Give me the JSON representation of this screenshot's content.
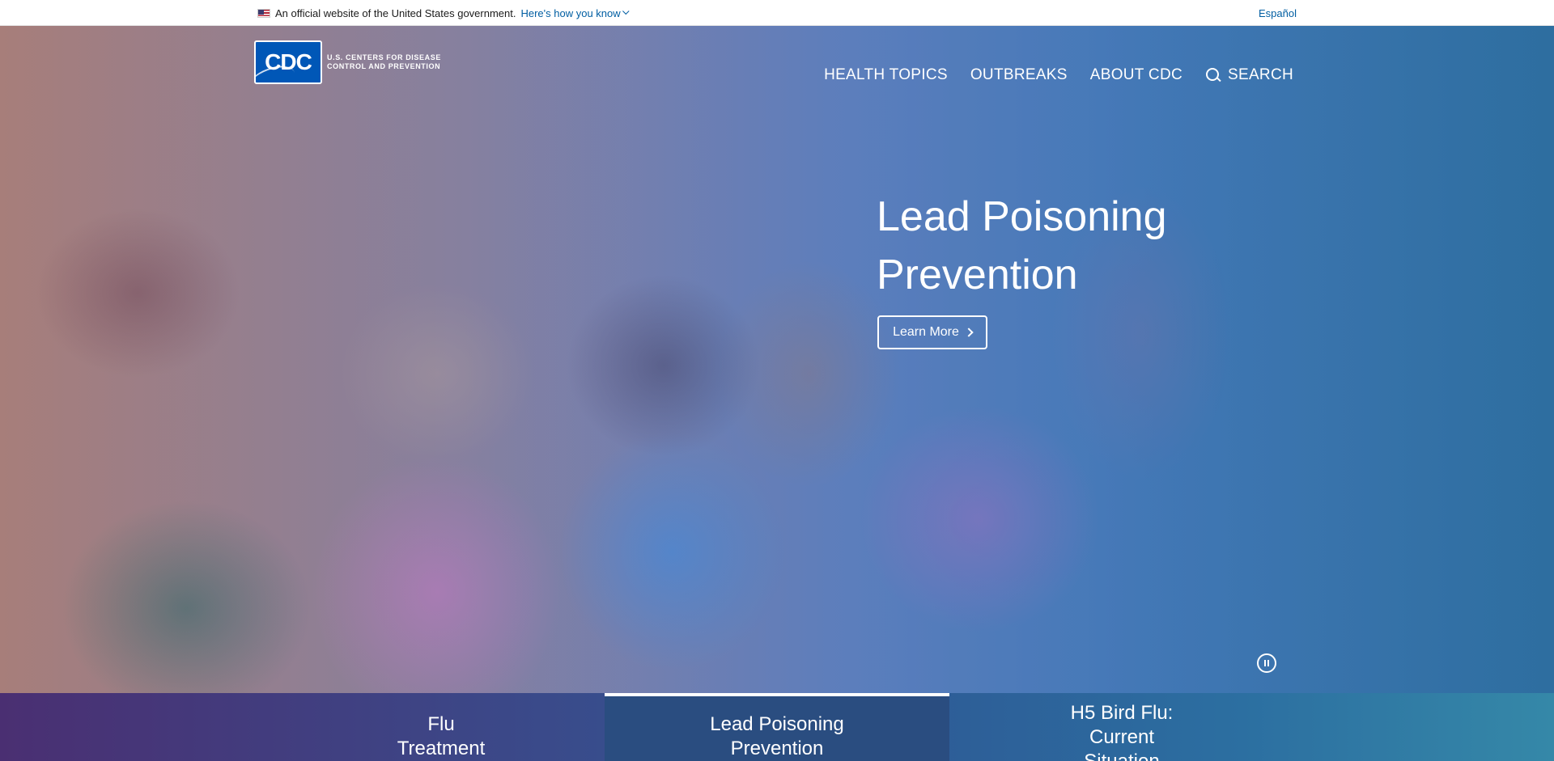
{
  "gov_banner": {
    "official_text": "An official website of the United States government.",
    "how_link": "Here's how you know",
    "language_link": "Español",
    "flag_icon": "us-flag-icon"
  },
  "header": {
    "logo_mark": "CDC",
    "logo_line1": "U.S. CENTERS FOR DISEASE",
    "logo_line2": "CONTROL AND PREVENTION",
    "nav": [
      "HEALTH TOPICS",
      "OUTBREAKS",
      "ABOUT CDC",
      "SEARCH"
    ],
    "search_icon": "search-icon"
  },
  "hero": {
    "title_line1": "Lead Poisoning",
    "title_line2": "Prevention",
    "button_label": "Learn More",
    "pause_icon": "pause-icon"
  },
  "tabs": [
    {
      "line1": "Flu",
      "line2": "Treatment"
    },
    {
      "line1": "Lead Poisoning",
      "line2": "Prevention",
      "active": true
    },
    {
      "line1": "H5 Bird Flu:",
      "line2": "Current",
      "line3": "Situation"
    }
  ],
  "colors": {
    "link": "#005ea2",
    "tab_active": "#2a4d80",
    "tabs_gradient_start": "#4a2f72",
    "tabs_gradient_end": "#3588a8"
  }
}
